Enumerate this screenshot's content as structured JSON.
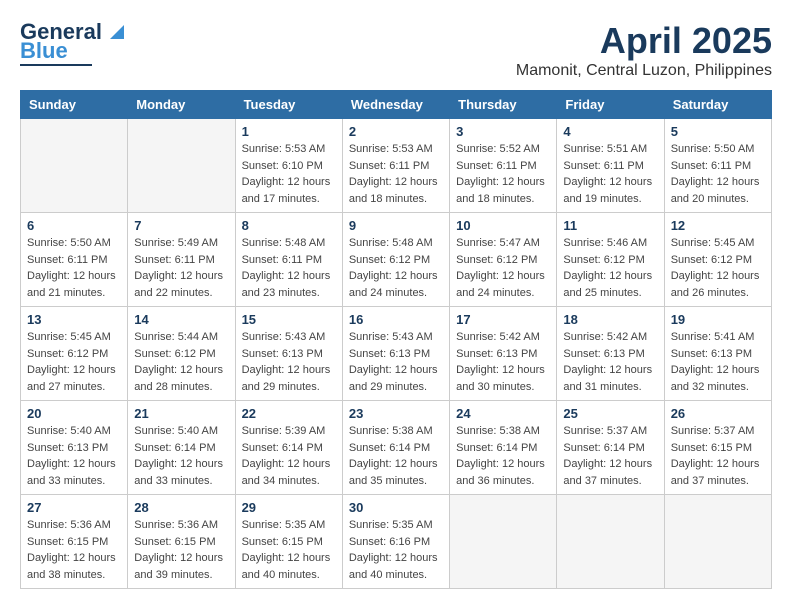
{
  "header": {
    "logo_line1": "General",
    "logo_line2": "Blue",
    "title": "April 2025",
    "subtitle": "Mamonit, Central Luzon, Philippines"
  },
  "weekdays": [
    "Sunday",
    "Monday",
    "Tuesday",
    "Wednesday",
    "Thursday",
    "Friday",
    "Saturday"
  ],
  "weeks": [
    [
      {
        "num": "",
        "detail": ""
      },
      {
        "num": "",
        "detail": ""
      },
      {
        "num": "1",
        "detail": "Sunrise: 5:53 AM\nSunset: 6:10 PM\nDaylight: 12 hours\nand 17 minutes."
      },
      {
        "num": "2",
        "detail": "Sunrise: 5:53 AM\nSunset: 6:11 PM\nDaylight: 12 hours\nand 18 minutes."
      },
      {
        "num": "3",
        "detail": "Sunrise: 5:52 AM\nSunset: 6:11 PM\nDaylight: 12 hours\nand 18 minutes."
      },
      {
        "num": "4",
        "detail": "Sunrise: 5:51 AM\nSunset: 6:11 PM\nDaylight: 12 hours\nand 19 minutes."
      },
      {
        "num": "5",
        "detail": "Sunrise: 5:50 AM\nSunset: 6:11 PM\nDaylight: 12 hours\nand 20 minutes."
      }
    ],
    [
      {
        "num": "6",
        "detail": "Sunrise: 5:50 AM\nSunset: 6:11 PM\nDaylight: 12 hours\nand 21 minutes."
      },
      {
        "num": "7",
        "detail": "Sunrise: 5:49 AM\nSunset: 6:11 PM\nDaylight: 12 hours\nand 22 minutes."
      },
      {
        "num": "8",
        "detail": "Sunrise: 5:48 AM\nSunset: 6:11 PM\nDaylight: 12 hours\nand 23 minutes."
      },
      {
        "num": "9",
        "detail": "Sunrise: 5:48 AM\nSunset: 6:12 PM\nDaylight: 12 hours\nand 24 minutes."
      },
      {
        "num": "10",
        "detail": "Sunrise: 5:47 AM\nSunset: 6:12 PM\nDaylight: 12 hours\nand 24 minutes."
      },
      {
        "num": "11",
        "detail": "Sunrise: 5:46 AM\nSunset: 6:12 PM\nDaylight: 12 hours\nand 25 minutes."
      },
      {
        "num": "12",
        "detail": "Sunrise: 5:45 AM\nSunset: 6:12 PM\nDaylight: 12 hours\nand 26 minutes."
      }
    ],
    [
      {
        "num": "13",
        "detail": "Sunrise: 5:45 AM\nSunset: 6:12 PM\nDaylight: 12 hours\nand 27 minutes."
      },
      {
        "num": "14",
        "detail": "Sunrise: 5:44 AM\nSunset: 6:12 PM\nDaylight: 12 hours\nand 28 minutes."
      },
      {
        "num": "15",
        "detail": "Sunrise: 5:43 AM\nSunset: 6:13 PM\nDaylight: 12 hours\nand 29 minutes."
      },
      {
        "num": "16",
        "detail": "Sunrise: 5:43 AM\nSunset: 6:13 PM\nDaylight: 12 hours\nand 29 minutes."
      },
      {
        "num": "17",
        "detail": "Sunrise: 5:42 AM\nSunset: 6:13 PM\nDaylight: 12 hours\nand 30 minutes."
      },
      {
        "num": "18",
        "detail": "Sunrise: 5:42 AM\nSunset: 6:13 PM\nDaylight: 12 hours\nand 31 minutes."
      },
      {
        "num": "19",
        "detail": "Sunrise: 5:41 AM\nSunset: 6:13 PM\nDaylight: 12 hours\nand 32 minutes."
      }
    ],
    [
      {
        "num": "20",
        "detail": "Sunrise: 5:40 AM\nSunset: 6:13 PM\nDaylight: 12 hours\nand 33 minutes."
      },
      {
        "num": "21",
        "detail": "Sunrise: 5:40 AM\nSunset: 6:14 PM\nDaylight: 12 hours\nand 33 minutes."
      },
      {
        "num": "22",
        "detail": "Sunrise: 5:39 AM\nSunset: 6:14 PM\nDaylight: 12 hours\nand 34 minutes."
      },
      {
        "num": "23",
        "detail": "Sunrise: 5:38 AM\nSunset: 6:14 PM\nDaylight: 12 hours\nand 35 minutes."
      },
      {
        "num": "24",
        "detail": "Sunrise: 5:38 AM\nSunset: 6:14 PM\nDaylight: 12 hours\nand 36 minutes."
      },
      {
        "num": "25",
        "detail": "Sunrise: 5:37 AM\nSunset: 6:14 PM\nDaylight: 12 hours\nand 37 minutes."
      },
      {
        "num": "26",
        "detail": "Sunrise: 5:37 AM\nSunset: 6:15 PM\nDaylight: 12 hours\nand 37 minutes."
      }
    ],
    [
      {
        "num": "27",
        "detail": "Sunrise: 5:36 AM\nSunset: 6:15 PM\nDaylight: 12 hours\nand 38 minutes."
      },
      {
        "num": "28",
        "detail": "Sunrise: 5:36 AM\nSunset: 6:15 PM\nDaylight: 12 hours\nand 39 minutes."
      },
      {
        "num": "29",
        "detail": "Sunrise: 5:35 AM\nSunset: 6:15 PM\nDaylight: 12 hours\nand 40 minutes."
      },
      {
        "num": "30",
        "detail": "Sunrise: 5:35 AM\nSunset: 6:16 PM\nDaylight: 12 hours\nand 40 minutes."
      },
      {
        "num": "",
        "detail": ""
      },
      {
        "num": "",
        "detail": ""
      },
      {
        "num": "",
        "detail": ""
      }
    ]
  ]
}
